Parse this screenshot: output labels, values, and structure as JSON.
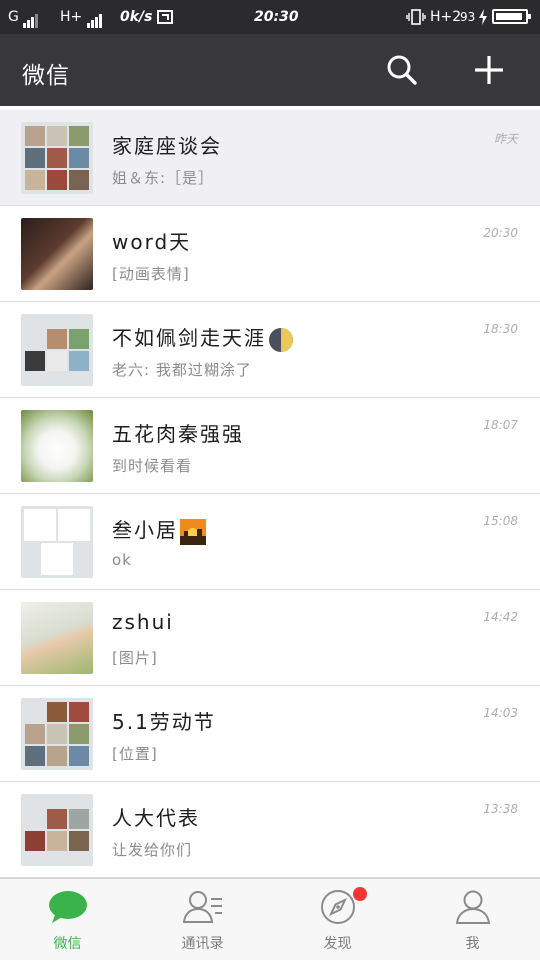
{
  "status_bar": {
    "carrier1": "G",
    "carrier2": "H+",
    "speed": "0k/s",
    "time": "20:30",
    "network": "H+2",
    "battery": "93",
    "battery_level": 0.93
  },
  "header": {
    "title": "微信"
  },
  "chats": [
    {
      "name": "家庭座谈会",
      "preview": "姐＆东:［是］",
      "time": "昨天",
      "highlighted": true
    },
    {
      "name": "word天",
      "preview": "[动画表情]",
      "time": "20:30"
    },
    {
      "name": "不如佩剑走天涯",
      "preview": "老六: 我都过糊涂了",
      "time": "18:30"
    },
    {
      "name": "五花肉秦强强",
      "preview": "到时候看看",
      "time": "18:07"
    },
    {
      "name": "叁小居",
      "preview": "ok",
      "time": "15:08"
    },
    {
      "name": "zshui",
      "preview": "[图片]",
      "time": "14:42"
    },
    {
      "name": "5.1劳动节",
      "preview": "[位置]",
      "time": "14:03"
    },
    {
      "name": "人大代表",
      "preview": "让发给你们",
      "time": "13:38"
    }
  ],
  "tabs": [
    {
      "label": "微信",
      "icon": "chat-bubble-icon",
      "active": true
    },
    {
      "label": "通讯录",
      "icon": "contacts-icon"
    },
    {
      "label": "发现",
      "icon": "compass-icon",
      "badge": true
    },
    {
      "label": "我",
      "icon": "person-icon"
    }
  ],
  "colors": {
    "status_bar_bg": "#2b2b2d",
    "header_bg": "#38383a",
    "accent_green": "#3ab44a",
    "badge_red": "#f43531"
  }
}
